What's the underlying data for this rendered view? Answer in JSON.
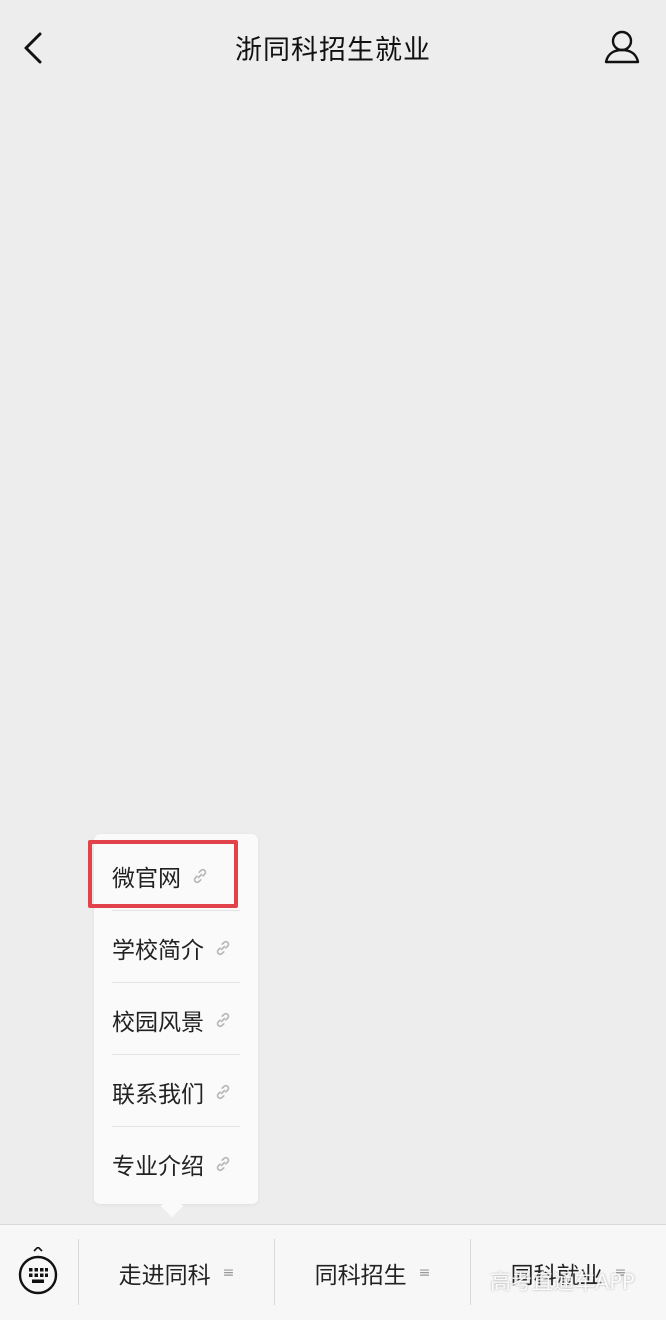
{
  "header": {
    "title": "浙同科招生就业"
  },
  "submenu": {
    "items": [
      {
        "label": "微官网",
        "icon": "link-icon"
      },
      {
        "label": "学校简介",
        "icon": "link-icon"
      },
      {
        "label": "校园风景",
        "icon": "link-icon"
      },
      {
        "label": "联系我们",
        "icon": "link-icon"
      },
      {
        "label": "专业介绍",
        "icon": "link-icon"
      }
    ],
    "highlighted_item": "微官网",
    "highlight_color": "#e2434b"
  },
  "menubar": {
    "keyboard_icon": "keyboard-icon",
    "tabs": [
      {
        "label": "走进同科",
        "icon": "menu-lines-icon"
      },
      {
        "label": "同科招生",
        "icon": "menu-lines-icon"
      },
      {
        "label": "同科就业",
        "icon": "menu-lines-icon"
      }
    ]
  },
  "watermark": {
    "text": "高考直通车APP"
  },
  "colors": {
    "background": "#ededed",
    "menubar_bg": "#f7f7f7",
    "text": "#222222"
  }
}
